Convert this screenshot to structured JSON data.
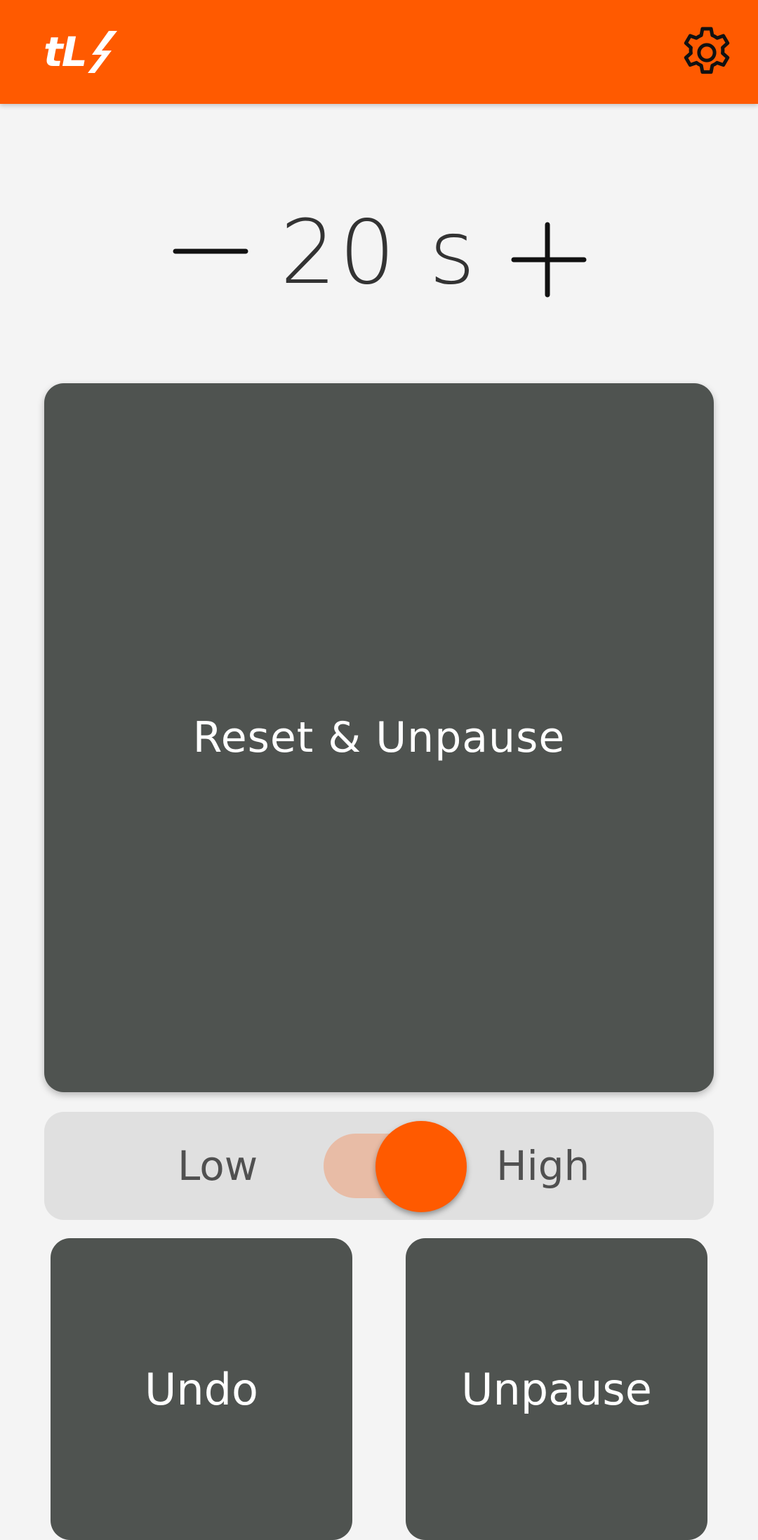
{
  "app": {
    "logo_text": "tL",
    "accent_color": "#ff5a00"
  },
  "header": {
    "settings_icon": "gear-icon"
  },
  "timer": {
    "value": "20 s",
    "decrease_icon": "minus-icon",
    "increase_icon": "plus-icon"
  },
  "main": {
    "reset_label": "Reset & Unpause"
  },
  "sensitivity": {
    "low_label": "Low",
    "high_label": "High",
    "toggle_state": "high"
  },
  "actions": {
    "undo_label": "Undo",
    "unpause_label": "Unpause"
  }
}
